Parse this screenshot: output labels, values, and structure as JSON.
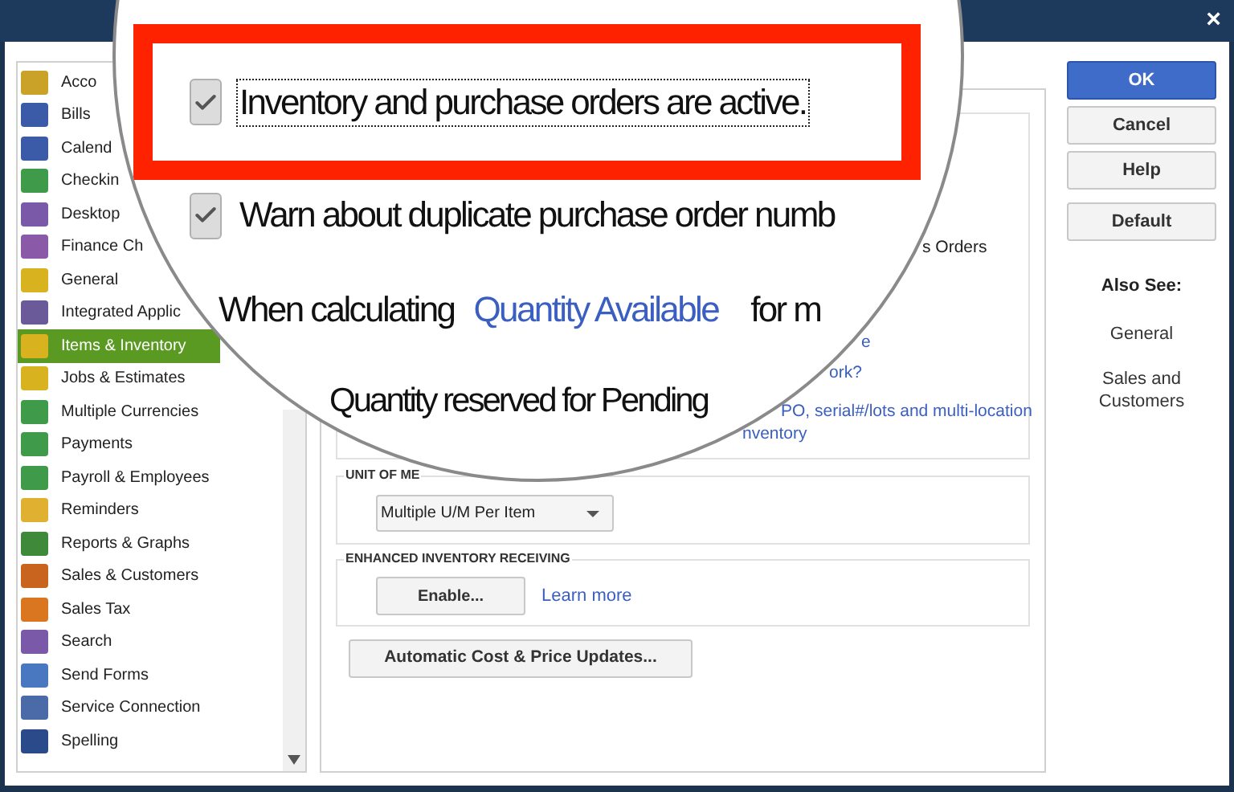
{
  "window": {
    "close": "×"
  },
  "sidebar": {
    "items": [
      {
        "label": "Acco",
        "selected": false,
        "color": "#c9a227"
      },
      {
        "label": "Bills",
        "selected": false,
        "color": "#3b5aa8"
      },
      {
        "label": "Calend",
        "selected": false,
        "color": "#3b5aa8"
      },
      {
        "label": "Checkin",
        "selected": false,
        "color": "#3f9a4a"
      },
      {
        "label": "Desktop",
        "selected": false,
        "color": "#7a5aa8"
      },
      {
        "label": "Finance Ch",
        "selected": false,
        "color": "#8a5aa8"
      },
      {
        "label": "General",
        "selected": false,
        "color": "#d9b21f"
      },
      {
        "label": "Integrated Applic",
        "selected": false,
        "color": "#6a5a9a"
      },
      {
        "label": "Items & Inventory",
        "selected": true,
        "color": "#d9b21f"
      },
      {
        "label": "Jobs & Estimates",
        "selected": false,
        "color": "#d9b21f"
      },
      {
        "label": "Multiple Currencies",
        "selected": false,
        "color": "#3f9a4a"
      },
      {
        "label": "Payments",
        "selected": false,
        "color": "#3f9a4a"
      },
      {
        "label": "Payroll & Employees",
        "selected": false,
        "color": "#3f9a4a"
      },
      {
        "label": "Reminders",
        "selected": false,
        "color": "#e0b030"
      },
      {
        "label": "Reports & Graphs",
        "selected": false,
        "color": "#3f8a3a"
      },
      {
        "label": "Sales & Customers",
        "selected": false,
        "color": "#c8641e"
      },
      {
        "label": "Sales Tax",
        "selected": false,
        "color": "#d9761f"
      },
      {
        "label": "Search",
        "selected": false,
        "color": "#7a5aa8"
      },
      {
        "label": "Send Forms",
        "selected": false,
        "color": "#4a78c0"
      },
      {
        "label": "Service Connection",
        "selected": false,
        "color": "#4a6aa8"
      },
      {
        "label": "Spelling",
        "selected": false,
        "color": "#2a4a8a"
      }
    ]
  },
  "panel": {
    "fragments": [
      "s Orders",
      "e",
      "ork?",
      "PO, serial#/lots and multi-location",
      "nventory"
    ],
    "unit_of_measure": {
      "title": "UNIT OF ME",
      "dropdown": "Multiple U/M Per Item"
    },
    "enhanced_receiving": {
      "title": "ENHANCED INVENTORY RECEIVING",
      "button": "Enable...",
      "link": "Learn more"
    },
    "auto_button": "Automatic Cost & Price Updates..."
  },
  "magnifier": {
    "options": [
      {
        "label": "Inventory and purchase orders are active.",
        "checked": true,
        "highlighted": true
      },
      {
        "label": "Warn about duplicate purchase order numb",
        "checked": true,
        "highlighted": false
      }
    ],
    "calc": {
      "prefix": "When calculating",
      "link": "Quantity Available",
      "suffix": "for m"
    },
    "reserved": "Quantity reserved for Pending"
  },
  "buttons": [
    {
      "label": "OK",
      "primary": true
    },
    {
      "label": "Cancel",
      "primary": false
    },
    {
      "label": "Help",
      "primary": false
    },
    {
      "label": "Default",
      "primary": false
    }
  ],
  "also_see": {
    "title": "Also See:",
    "links": [
      "General",
      "Sales and Customers"
    ]
  }
}
